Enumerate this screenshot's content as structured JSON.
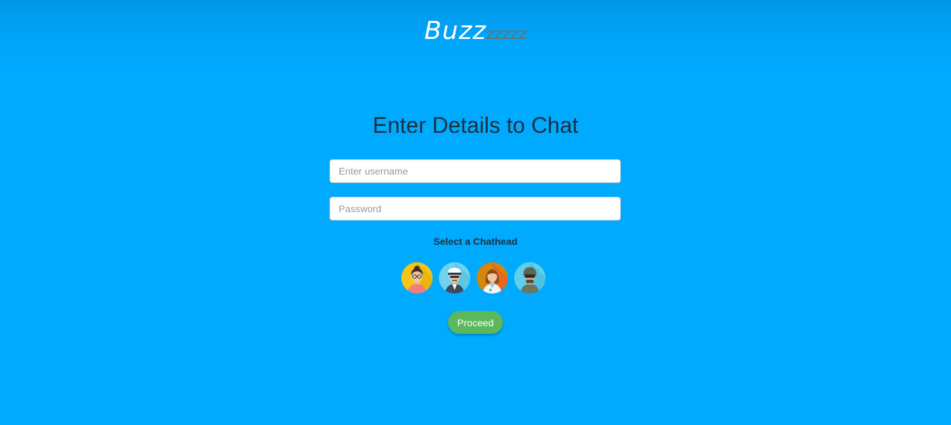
{
  "app": {
    "logo_main": "Buzz",
    "logo_tail": "zzzzz"
  },
  "form": {
    "title": "Enter Details to Chat",
    "username": {
      "value": "",
      "placeholder": "Enter username"
    },
    "password": {
      "value": "",
      "placeholder": "Password"
    },
    "chathead_label": "Select a Chathead",
    "chatheads": [
      {
        "icon": "woman-with-glasses-icon",
        "bg": "#f5c518"
      },
      {
        "icon": "pilot-icon",
        "bg": "#6fd3ee"
      },
      {
        "icon": "doctor-woman-icon",
        "bg": "#d4860e"
      },
      {
        "icon": "soldier-icon",
        "bg": "#5fd0e8"
      }
    ],
    "proceed_label": "Proceed"
  },
  "colors": {
    "background": "#00aaff",
    "title_text": "#1d3140",
    "proceed_button": "#5cb85c"
  }
}
